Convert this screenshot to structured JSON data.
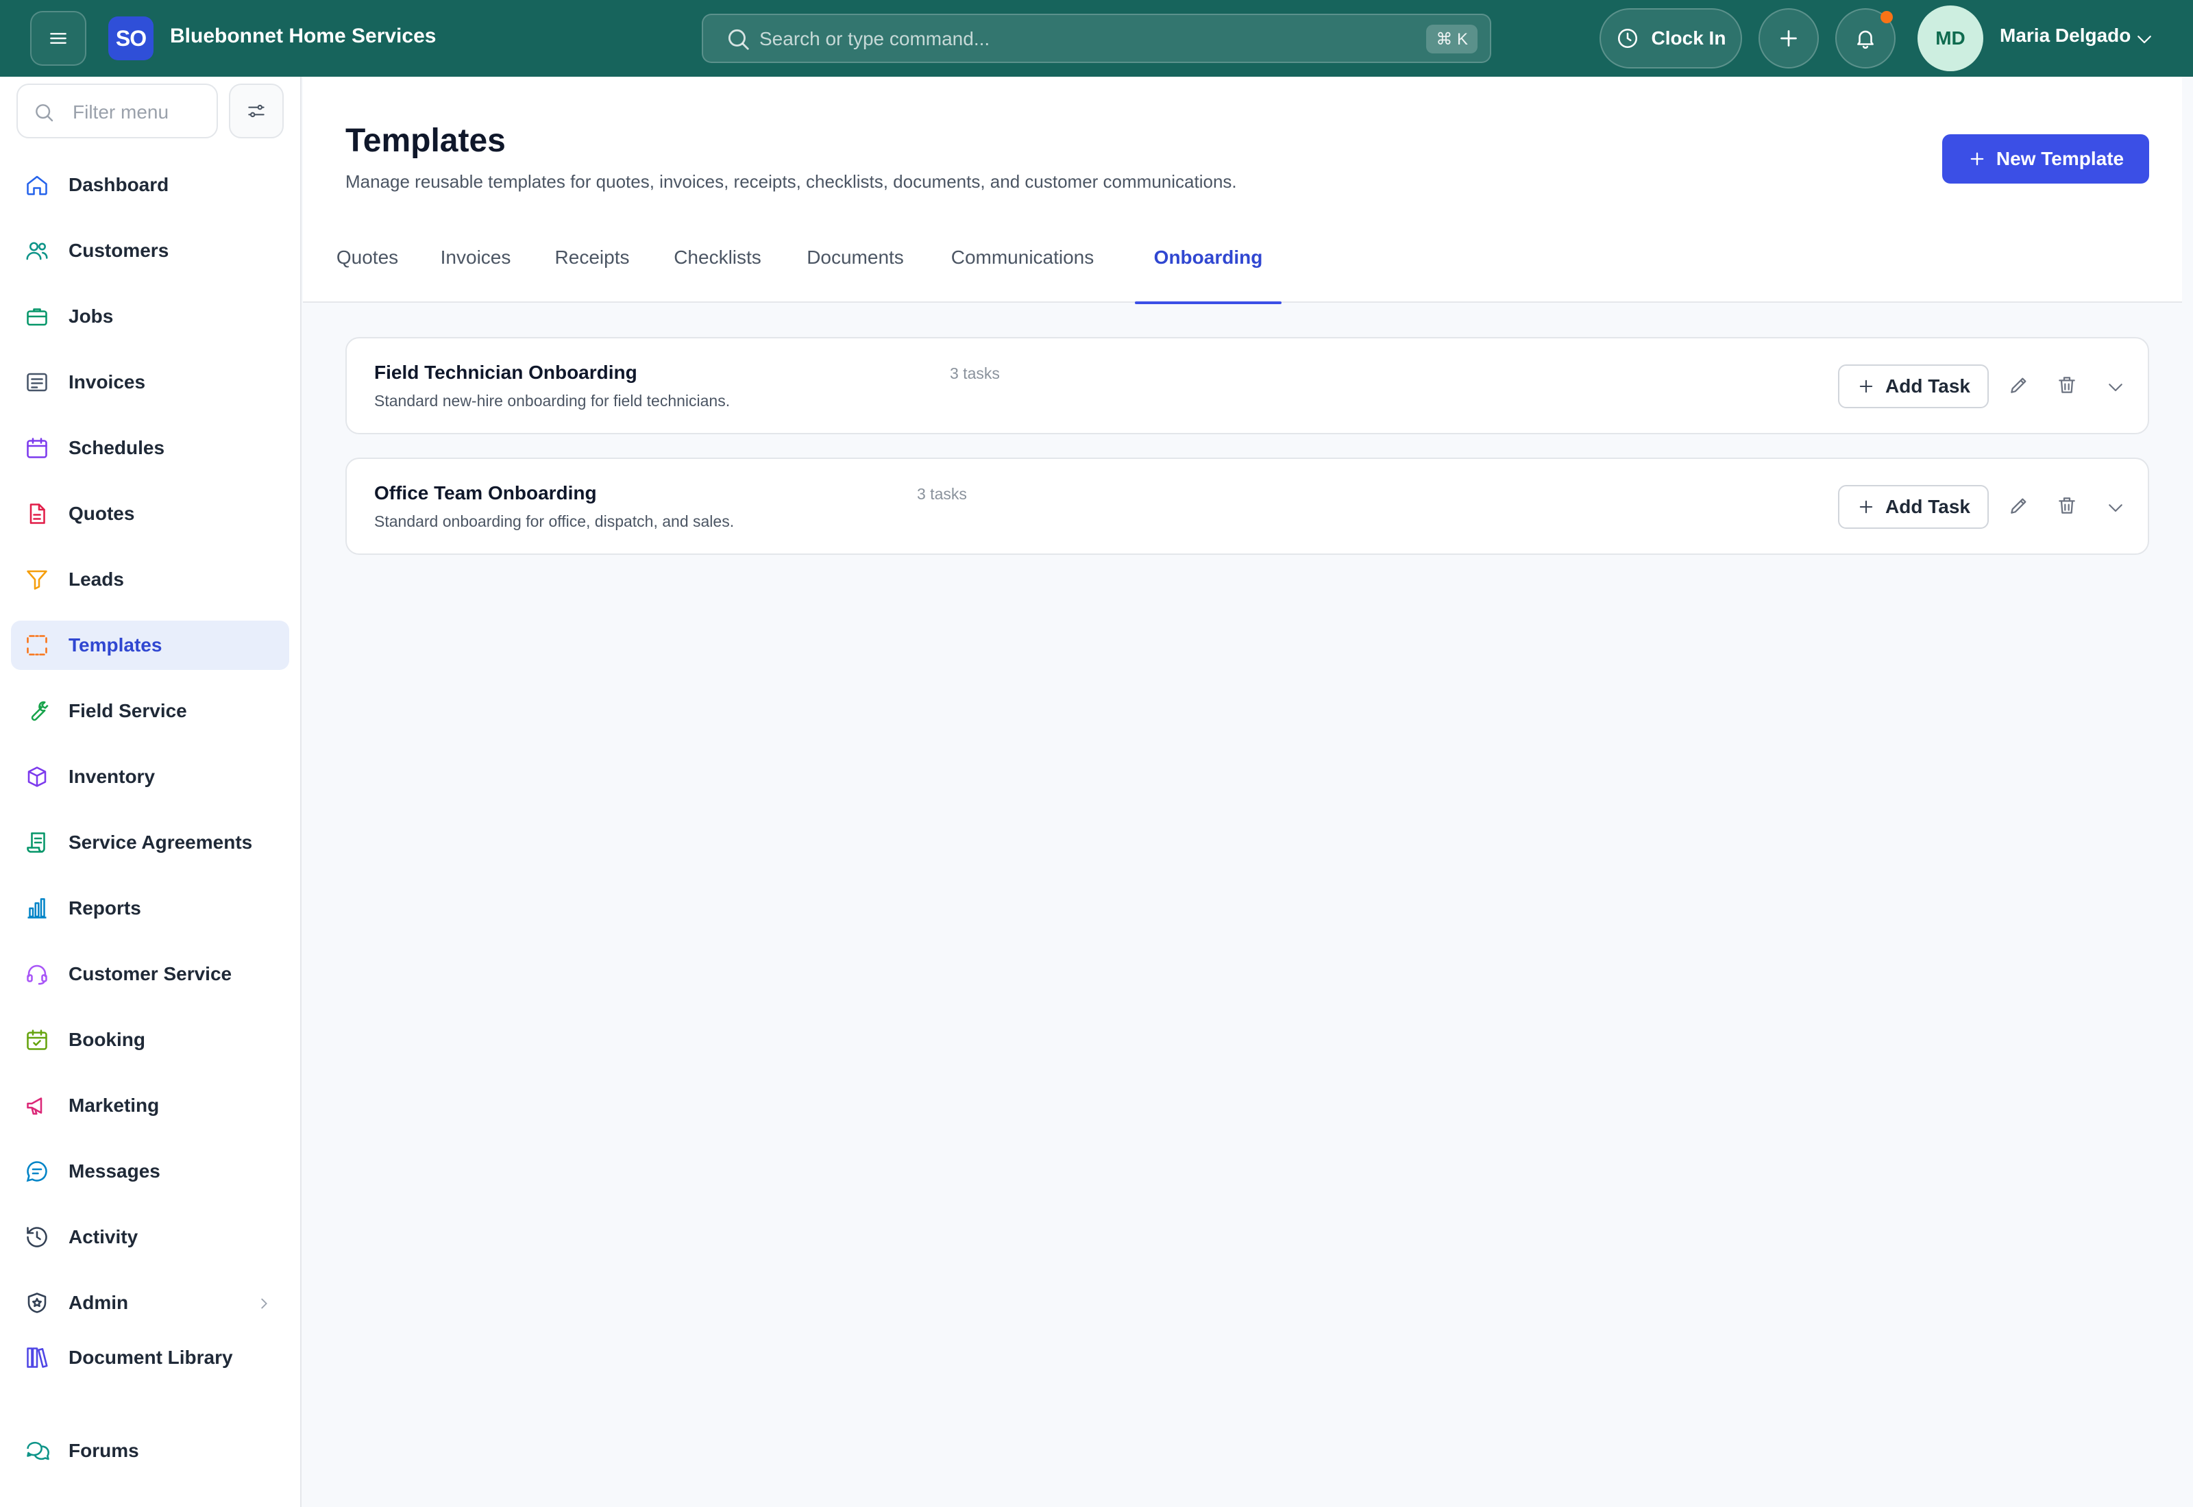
{
  "topbar": {
    "logo_text": "SO",
    "brand": "Bluebonnet Home Services",
    "search_placeholder": "Search or type command...",
    "search_shortcut": "⌘ K",
    "clock_in_label": "Clock In",
    "avatar_initials": "MD",
    "user_name": "Maria Delgado",
    "accent_color": "#17645c"
  },
  "sidebar": {
    "filter_placeholder": "Filter menu",
    "items": [
      {
        "label": "Dashboard",
        "icon": "home-icon",
        "color": "#2563eb"
      },
      {
        "label": "Customers",
        "icon": "users-icon",
        "color": "#0d9488"
      },
      {
        "label": "Jobs",
        "icon": "briefcase-icon",
        "color": "#059669"
      },
      {
        "label": "Invoices",
        "icon": "invoice-icon",
        "color": "#475569"
      },
      {
        "label": "Schedules",
        "icon": "calendar-icon",
        "color": "#7c3aed"
      },
      {
        "label": "Quotes",
        "icon": "file-icon",
        "color": "#e11d48"
      },
      {
        "label": "Leads",
        "icon": "funnel-icon",
        "color": "#f59e0b"
      },
      {
        "label": "Templates",
        "icon": "template-icon",
        "color": "#f97316"
      },
      {
        "label": "Field Service",
        "icon": "wrench-icon",
        "color": "#16a34a"
      },
      {
        "label": "Inventory",
        "icon": "box-icon",
        "color": "#7c3aed"
      },
      {
        "label": "Service Agreements",
        "icon": "scroll-icon",
        "color": "#059669"
      },
      {
        "label": "Reports",
        "icon": "bar-chart-icon",
        "color": "#0284c7"
      },
      {
        "label": "Customer Service",
        "icon": "headset-icon",
        "color": "#a855f7"
      },
      {
        "label": "Booking",
        "icon": "calendar-check-icon",
        "color": "#65a30d"
      },
      {
        "label": "Marketing",
        "icon": "megaphone-icon",
        "color": "#db2777"
      },
      {
        "label": "Messages",
        "icon": "chat-icon",
        "color": "#0284c7"
      },
      {
        "label": "Activity",
        "icon": "history-icon",
        "color": "#334155"
      },
      {
        "label": "Admin",
        "icon": "shield-icon",
        "color": "#334155"
      },
      {
        "label": "Document Library",
        "icon": "library-icon",
        "color": "#4f46e5"
      },
      {
        "label": "Forums",
        "icon": "forum-icon",
        "color": "#0d9488"
      }
    ],
    "active": "Templates"
  },
  "page": {
    "title": "Templates",
    "subtitle": "Manage reusable templates for quotes, invoices, receipts, checklists, documents, and customer communications.",
    "new_button": "New Template",
    "primary_color": "#3b4fe6"
  },
  "tabs": [
    "Quotes",
    "Invoices",
    "Receipts",
    "Checklists",
    "Documents",
    "Communications",
    "Onboarding"
  ],
  "active_tab": "Onboarding",
  "templates": [
    {
      "title": "Field Technician Onboarding",
      "count": "3 tasks",
      "description": "Standard new-hire onboarding for field technicians.",
      "add_label": "Add Task"
    },
    {
      "title": "Office Team Onboarding",
      "count": "3 tasks",
      "description": "Standard onboarding for office, dispatch, and sales.",
      "add_label": "Add Task"
    }
  ]
}
